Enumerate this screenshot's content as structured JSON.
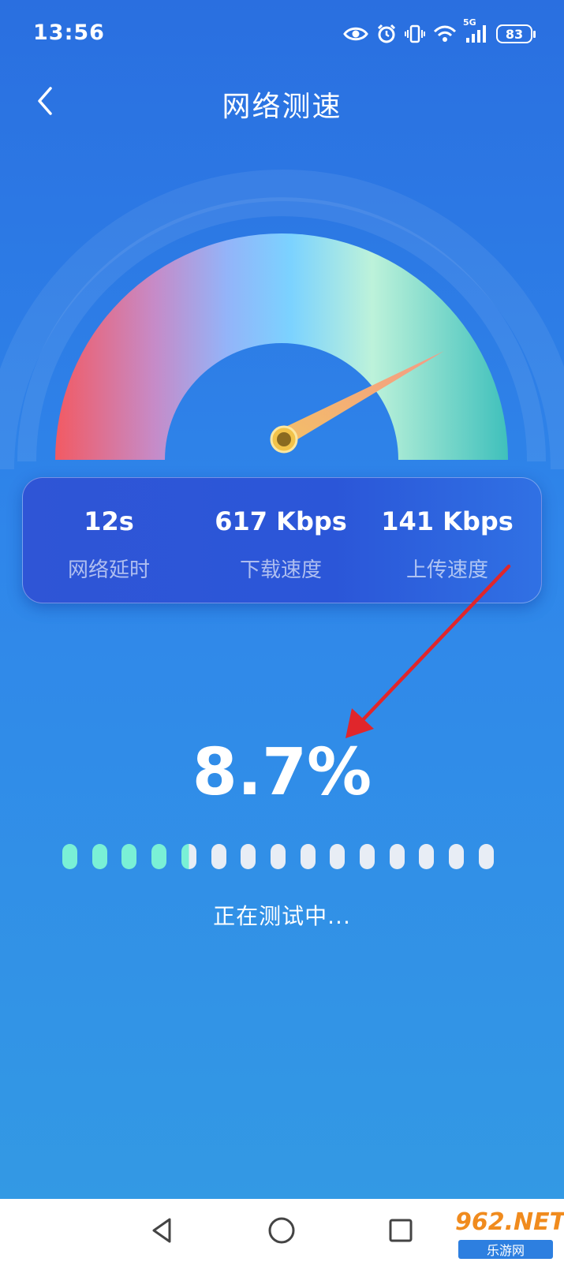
{
  "status_bar": {
    "time": "13:56",
    "network_type": "5G",
    "battery": "83",
    "icons": [
      "eye-icon",
      "alarm-icon",
      "vibrate-icon",
      "wifi-icon",
      "signal-icon",
      "battery-icon"
    ]
  },
  "header": {
    "title": "网络测速",
    "back_icon": "chevron-left-icon"
  },
  "gauge": {
    "colors": {
      "low": "#f0606a",
      "mid_low": "#9ab0f6",
      "mid": "#7bd0ff",
      "mid_high": "#b8f0d8",
      "high": "#4cc8bf",
      "needle": "#f5c36a",
      "hub": "#f2c34a"
    }
  },
  "stats": [
    {
      "value": "12s",
      "label": "网络延时"
    },
    {
      "value": "617 Kbps",
      "label": "下载速度"
    },
    {
      "value": "141 Kbps",
      "label": "上传速度"
    }
  ],
  "progress": {
    "percent_text": "8.7%",
    "total_segments": 15,
    "filled_segments": 4.5,
    "fill_color": "#7af0d6",
    "empty_color": "#e8edf5"
  },
  "status_text": "正在测试中...",
  "annotation_arrow_color": "#e0262b",
  "nav_bar": {
    "icons": [
      "back-triangle-icon",
      "home-circle-icon",
      "recents-square-icon"
    ]
  },
  "watermark": {
    "brand": "962.NET",
    "sub": "乐游网"
  }
}
